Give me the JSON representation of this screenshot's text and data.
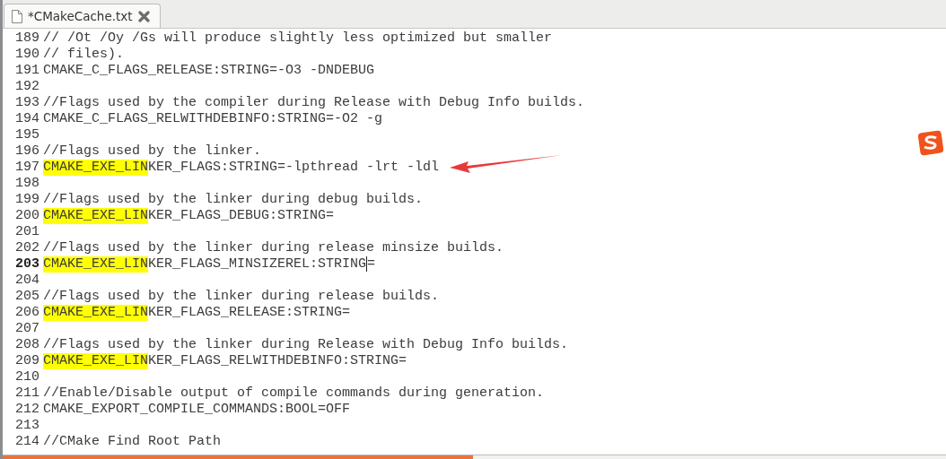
{
  "tab": {
    "title": "*CMakeCache.txt"
  },
  "lines": [
    {
      "number": "189",
      "text": "// /Ot /Oy /Gs will produce slightly less optimized but smaller",
      "current": false
    },
    {
      "number": "190",
      "text": "// files).",
      "current": false
    },
    {
      "number": "191",
      "text": "CMAKE_C_FLAGS_RELEASE:STRING=-O3 -DNDEBUG",
      "current": false
    },
    {
      "number": "192",
      "current": false
    },
    {
      "number": "193",
      "text": "//Flags used by the compiler during Release with Debug Info builds.",
      "current": false
    },
    {
      "number": "194",
      "text": "CMAKE_C_FLAGS_RELWITHDEBINFO:STRING=-O2 -g",
      "current": false
    },
    {
      "number": "195",
      "current": false
    },
    {
      "number": "196",
      "text": "//Flags used by the linker.",
      "current": false
    },
    {
      "number": "197",
      "match": "CMAKE_EXE_LIN",
      "text": "KER_FLAGS:STRING=-lpthread -lrt -ldl",
      "current": false
    },
    {
      "number": "198",
      "current": false
    },
    {
      "number": "199",
      "text": "//Flags used by the linker during debug builds.",
      "current": false
    },
    {
      "number": "200",
      "match": "CMAKE_EXE_LIN",
      "text": "KER_FLAGS_DEBUG:STRING=",
      "current": false
    },
    {
      "number": "201",
      "current": false
    },
    {
      "number": "202",
      "text": "//Flags used by the linker during release minsize builds.",
      "current": false
    },
    {
      "number": "203",
      "match": "CMAKE_EXE_LIN",
      "text": "KER_FLAGS_MINSIZEREL:STRING",
      "after_cursor": "=",
      "current": true
    },
    {
      "number": "204",
      "current": false
    },
    {
      "number": "205",
      "text": "//Flags used by the linker during release builds.",
      "current": false
    },
    {
      "number": "206",
      "match": "CMAKE_EXE_LIN",
      "text": "KER_FLAGS_RELEASE:STRING=",
      "current": false
    },
    {
      "number": "207",
      "current": false
    },
    {
      "number": "208",
      "text": "//Flags used by the linker during Release with Debug Info builds.",
      "current": false
    },
    {
      "number": "209",
      "match": "CMAKE_EXE_LIN",
      "text": "KER_FLAGS_RELWITHDEBINFO:STRING=",
      "current": false
    },
    {
      "number": "210",
      "current": false
    },
    {
      "number": "211",
      "text": "//Enable/Disable output of compile commands during generation.",
      "current": false
    },
    {
      "number": "212",
      "text": "CMAKE_EXPORT_COMPILE_COMMANDS:BOOL=OFF",
      "current": false
    },
    {
      "number": "213",
      "current": false
    },
    {
      "number": "214",
      "text": "//CMake Find Root Path",
      "current": false
    }
  ]
}
